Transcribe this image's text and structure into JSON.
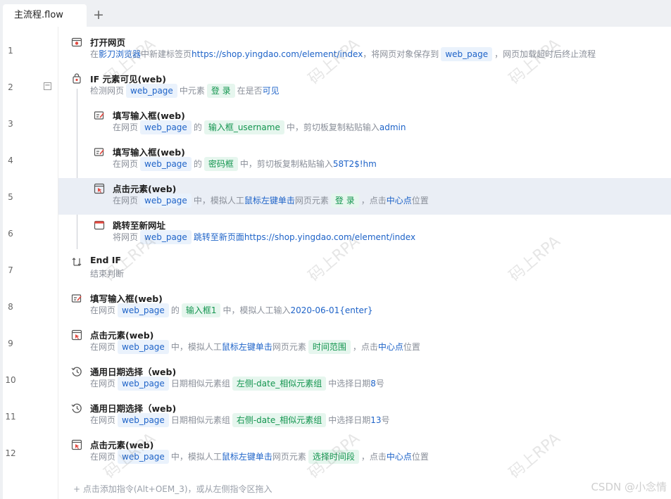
{
  "tab": {
    "title": "主流程.flow",
    "add_icon": "+"
  },
  "lines": [
    "1",
    "2",
    "3",
    "4",
    "5",
    "6",
    "7",
    "8",
    "9",
    "10",
    "11",
    "12"
  ],
  "collapse_symbol": "−",
  "rows": [
    {
      "title": "打开网页",
      "icon": "browser-open-icon",
      "desc": [
        {
          "t": "在 "
        },
        {
          "t": "影刀浏览器",
          "c": "val"
        },
        {
          "t": " 中新建标签页 "
        },
        {
          "t": "https://shop.yingdao.com/element/index",
          "c": "val"
        },
        {
          "t": " ，将网页对象保存到 "
        },
        {
          "t": "web_page",
          "c": "tagb"
        },
        {
          "t": " ，网页加载超时后终止流程"
        }
      ]
    },
    {
      "title": "IF 元素可见(web)",
      "icon": "if-element-icon",
      "desc": [
        {
          "t": "检测网页 "
        },
        {
          "t": "web_page",
          "c": "tagb"
        },
        {
          "t": " 中元素 "
        },
        {
          "t": "登 录",
          "c": "tagg"
        },
        {
          "t": " 在是否 "
        },
        {
          "t": "可见",
          "c": "val"
        }
      ]
    },
    {
      "title": "填写输入框(web)",
      "icon": "fill-input-icon",
      "desc": [
        {
          "t": "在网页 "
        },
        {
          "t": "web_page",
          "c": "tagb"
        },
        {
          "t": " 的 "
        },
        {
          "t": "输入框_username",
          "c": "tagg"
        },
        {
          "t": " 中，剪切板复制粘贴输入 "
        },
        {
          "t": "admin",
          "c": "val"
        }
      ]
    },
    {
      "title": "填写输入框(web)",
      "icon": "fill-input-icon",
      "desc": [
        {
          "t": "在网页 "
        },
        {
          "t": "web_page",
          "c": "tagb"
        },
        {
          "t": " 的 "
        },
        {
          "t": "密码框",
          "c": "tagg"
        },
        {
          "t": " 中，剪切板复制粘贴输入 "
        },
        {
          "t": "58T2$!hm",
          "c": "val"
        }
      ]
    },
    {
      "title": "点击元素(web)",
      "icon": "click-element-icon",
      "desc": [
        {
          "t": "在网页 "
        },
        {
          "t": "web_page",
          "c": "tagb"
        },
        {
          "t": " 中，模拟人工 "
        },
        {
          "t": "鼠标左键",
          "c": "val"
        },
        {
          "t": " "
        },
        {
          "t": "单击",
          "c": "val"
        },
        {
          "t": " 网页元素 "
        },
        {
          "t": "登 录",
          "c": "tagg"
        },
        {
          "t": " ，点击 "
        },
        {
          "t": "中心点",
          "c": "val"
        },
        {
          "t": " 位置"
        }
      ]
    },
    {
      "title": "跳转至新网址",
      "icon": "goto-url-icon",
      "desc": [
        {
          "t": "将网页 "
        },
        {
          "t": "web_page",
          "c": "tagb"
        },
        {
          "t": " "
        },
        {
          "t": "跳转至新页面",
          "c": "val"
        },
        {
          "t": " "
        },
        {
          "t": "https://shop.yingdao.com/element/index",
          "c": "val"
        }
      ]
    },
    {
      "title": "End IF",
      "icon": "end-if-icon",
      "desc": [
        {
          "t": "结束判断"
        }
      ]
    },
    {
      "title": "填写输入框(web)",
      "icon": "fill-input-icon",
      "desc": [
        {
          "t": "在网页 "
        },
        {
          "t": "web_page",
          "c": "tagb"
        },
        {
          "t": " 的 "
        },
        {
          "t": "输入框1",
          "c": "tagg"
        },
        {
          "t": " 中，模拟人工输入 "
        },
        {
          "t": "2020-06-01{enter}",
          "c": "val"
        }
      ]
    },
    {
      "title": "点击元素(web)",
      "icon": "click-element-icon",
      "desc": [
        {
          "t": "在网页 "
        },
        {
          "t": "web_page",
          "c": "tagb"
        },
        {
          "t": " 中，模拟人工 "
        },
        {
          "t": "鼠标左键",
          "c": "val"
        },
        {
          "t": " "
        },
        {
          "t": "单击",
          "c": "val"
        },
        {
          "t": " 网页元素 "
        },
        {
          "t": "时间范围",
          "c": "tagg"
        },
        {
          "t": " ，点击 "
        },
        {
          "t": "中心点",
          "c": "val"
        },
        {
          "t": " 位置"
        }
      ]
    },
    {
      "title": "通用日期选择（web)",
      "icon": "date-picker-icon",
      "desc": [
        {
          "t": "在网页 "
        },
        {
          "t": "web_page",
          "c": "tagb"
        },
        {
          "t": " 日期相似元素组 "
        },
        {
          "t": "左侧-date_相似元素组",
          "c": "tagg"
        },
        {
          "t": " 中选择日期 "
        },
        {
          "t": "8",
          "c": "val"
        },
        {
          "t": " 号"
        }
      ]
    },
    {
      "title": "通用日期选择（web)",
      "icon": "date-picker-icon",
      "desc": [
        {
          "t": "在网页 "
        },
        {
          "t": "web_page",
          "c": "tagb"
        },
        {
          "t": " 日期相似元素组 "
        },
        {
          "t": "右侧-date_相似元素组",
          "c": "tagg"
        },
        {
          "t": " 中选择日期 "
        },
        {
          "t": "13",
          "c": "val"
        },
        {
          "t": " 号"
        }
      ]
    },
    {
      "title": "点击元素(web)",
      "icon": "click-element-icon",
      "desc": [
        {
          "t": "在网页 "
        },
        {
          "t": "web_page",
          "c": "tagb"
        },
        {
          "t": " 中，模拟人工 "
        },
        {
          "t": "鼠标左键",
          "c": "val"
        },
        {
          "t": " "
        },
        {
          "t": "单击",
          "c": "val"
        },
        {
          "t": " 网页元素 "
        },
        {
          "t": "选择时间段",
          "c": "tagg"
        },
        {
          "t": " ，点击 "
        },
        {
          "t": "中心点",
          "c": "val"
        },
        {
          "t": " 位置"
        }
      ]
    }
  ],
  "add_hint": "+ 点击添加指令(Alt+OEM_3)，或从左侧指令区拖入",
  "watermark": "码上RPA",
  "csdn": "CSDN @小念情"
}
